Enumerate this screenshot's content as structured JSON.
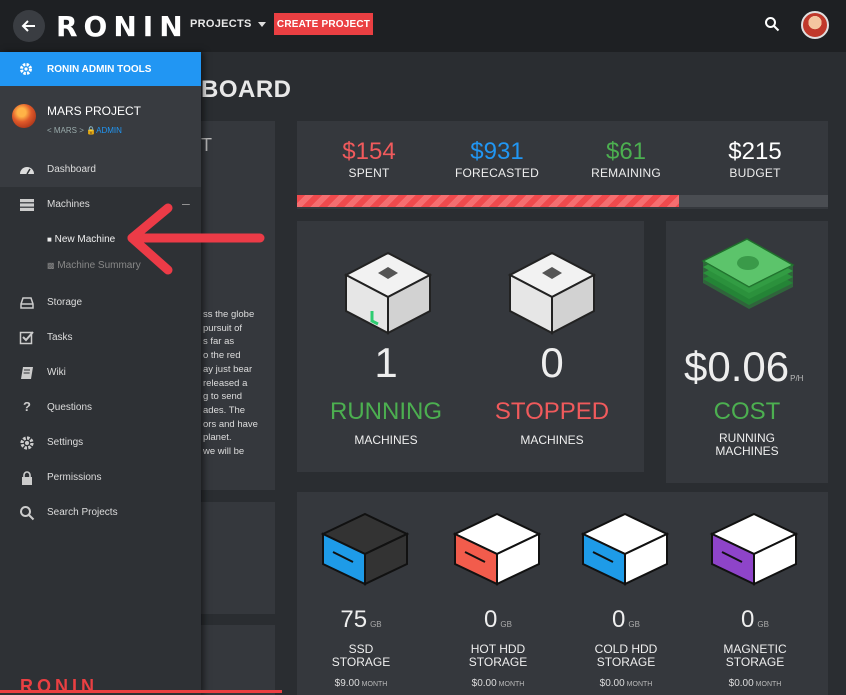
{
  "topbar": {
    "logo": "RONIN",
    "projects_label": "PROJECTS",
    "create_label": "CREATE PROJECT",
    "icons": {
      "back": "arrow-left-icon",
      "search": "search-icon"
    }
  },
  "dashboard": {
    "title_fragment": "BOARD",
    "left_card_fragment": "T",
    "intro_lines": [
      "ss the globe",
      "pursuit of",
      "s far as",
      "o the red",
      "ay just bear",
      "released a",
      "g to send",
      "ades. The",
      "ors and have",
      "planet.",
      "we will be"
    ],
    "budget": {
      "spent": {
        "value": "$154",
        "label": "SPENT",
        "color": "#f05a5c"
      },
      "forecasted": {
        "value": "$931",
        "label": "FORECASTED",
        "color": "#2196f3"
      },
      "remaining": {
        "value": "$61",
        "label": "REMAINING",
        "color": "#4caf50"
      },
      "budget": {
        "value": "$215",
        "label": "BUDGET",
        "color": "#ffffff"
      },
      "spent_fraction": 0.72
    },
    "machines": {
      "running": {
        "count": "1",
        "status": "RUNNING",
        "label": "MACHINES",
        "color": "#4caf50"
      },
      "stopped": {
        "count": "0",
        "status": "STOPPED",
        "label": "MACHINES",
        "color": "#f05a5c"
      }
    },
    "cost": {
      "value": "$0.06",
      "unit": "P/H",
      "status": "COST",
      "label_line1": "RUNNING",
      "label_line2": "MACHINES"
    },
    "storage": [
      {
        "amount": "75",
        "unit": "GB",
        "line1": "SSD",
        "line2": "STORAGE",
        "price": "$9.00",
        "price_unit": "MONTH",
        "color": "#1e9be8"
      },
      {
        "amount": "0",
        "unit": "GB",
        "line1": "HOT HDD",
        "line2": "STORAGE",
        "price": "$0.00",
        "price_unit": "MONTH",
        "color": "#f25c4c"
      },
      {
        "amount": "0",
        "unit": "GB",
        "line1": "COLD HDD",
        "line2": "STORAGE",
        "price": "$0.00",
        "price_unit": "MONTH",
        "color": "#1e9be8"
      },
      {
        "amount": "0",
        "unit": "GB",
        "line1": "MAGNETIC",
        "line2": "STORAGE",
        "price": "$0.00",
        "price_unit": "MONTH",
        "color": "#8e44c9"
      }
    ]
  },
  "drawer": {
    "admin_tools": "RONIN ADMIN TOOLS",
    "project_name": "MARS PROJECT",
    "project_breadcrumb": "< MARS >",
    "project_role": "ADMIN",
    "nav": [
      {
        "label": "Dashboard",
        "icon": "dashboard-icon"
      },
      {
        "label": "Machines",
        "icon": "server-icon"
      },
      {
        "label": "Storage",
        "icon": "hard-drive-icon"
      },
      {
        "label": "Tasks",
        "icon": "checkbox-icon"
      },
      {
        "label": "Wiki",
        "icon": "book-icon"
      },
      {
        "label": "Questions",
        "icon": "question-icon"
      },
      {
        "label": "Settings",
        "icon": "gear-icon"
      },
      {
        "label": "Permissions",
        "icon": "lock-icon"
      },
      {
        "label": "Search Projects",
        "icon": "search-icon"
      }
    ],
    "machines_sub": [
      "New Machine",
      "Machine Summary"
    ],
    "collapse_symbol": "–",
    "footer_logo": "RONIN"
  }
}
